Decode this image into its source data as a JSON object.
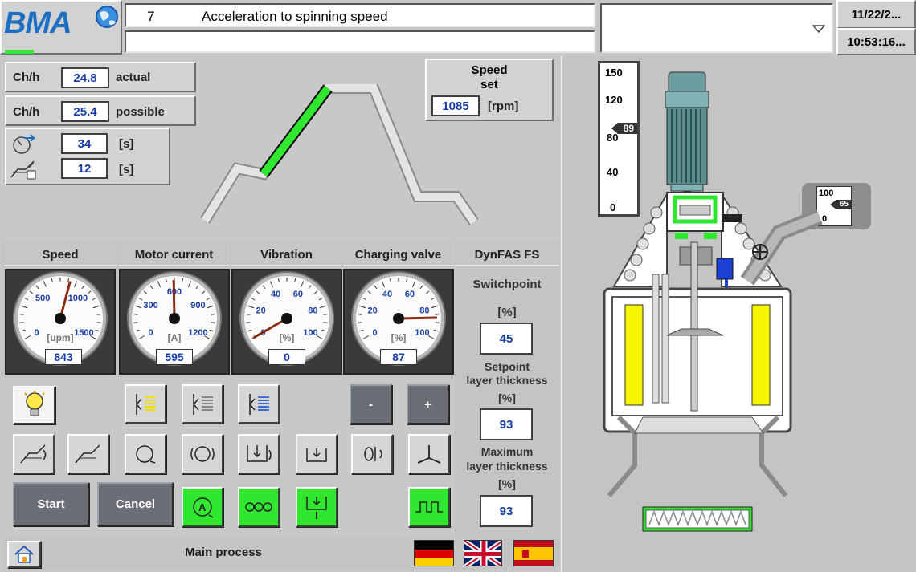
{
  "header": {
    "logo_text": "BMA",
    "step_number": "7",
    "step_text": "Acceleration to spinning speed",
    "secondary_message": "",
    "dropdown_value": "",
    "date": "11/22/2...",
    "time": "10:53:16..."
  },
  "throughput": {
    "actual_unit": "Ch/h",
    "actual_value": "24.8",
    "actual_label": "actual",
    "possible_unit": "Ch/h",
    "possible_value": "25.4",
    "possible_label": "possible",
    "time1_value": "34",
    "time1_unit": "[s]",
    "time2_value": "12",
    "time2_unit": "[s]"
  },
  "speed_set": {
    "title_line1": "Speed",
    "title_line2": "set",
    "value": "1085",
    "unit": "[rpm]"
  },
  "gauges": [
    {
      "title": "Speed",
      "unit": "[upm]",
      "value": "843",
      "ticks": [
        "0",
        "500",
        "1000",
        "1500"
      ],
      "fraction": 0.562
    },
    {
      "title": "Motor current",
      "unit": "[A]",
      "value": "595",
      "ticks": [
        "0",
        "300",
        "600",
        "900",
        "1200"
      ],
      "fraction": 0.496
    },
    {
      "title": "Vibration",
      "unit": "[%]",
      "value": "0",
      "ticks": [
        "0",
        "20",
        "40",
        "60",
        "80",
        "100"
      ],
      "fraction": 0.0
    },
    {
      "title": "Charging valve",
      "unit": "[%]",
      "value": "87",
      "ticks": [
        "0",
        "20",
        "40",
        "60",
        "80",
        "100"
      ],
      "fraction": 0.87
    }
  ],
  "dynfas": {
    "title": "DynFAS FS",
    "switchpoint_label": "Switchpoint",
    "switchpoint_unit": "[%]",
    "switchpoint_value": "45",
    "setpoint_label_line1": "Setpoint",
    "setpoint_label_line2": "layer thickness",
    "setpoint_unit": "[%]",
    "setpoint_value": "93",
    "max_label_line1": "Maximum",
    "max_label_line2": "layer thickness",
    "max_unit": "[%]",
    "max_value": "93"
  },
  "buttons": {
    "minus": "-",
    "plus": "+",
    "start": "Start",
    "cancel": "Cancel"
  },
  "scale_main": {
    "ticks": [
      "150",
      "120",
      "80",
      "40",
      "0"
    ],
    "pointer": "89"
  },
  "scale_small": {
    "top": "100",
    "bottom": "0",
    "pointer": "65"
  },
  "footer": {
    "title": "Main process"
  },
  "colors": {
    "active_green": "#2fe72f",
    "value_blue": "#1a3ea8",
    "screen_gray": "#c8c8c8"
  }
}
